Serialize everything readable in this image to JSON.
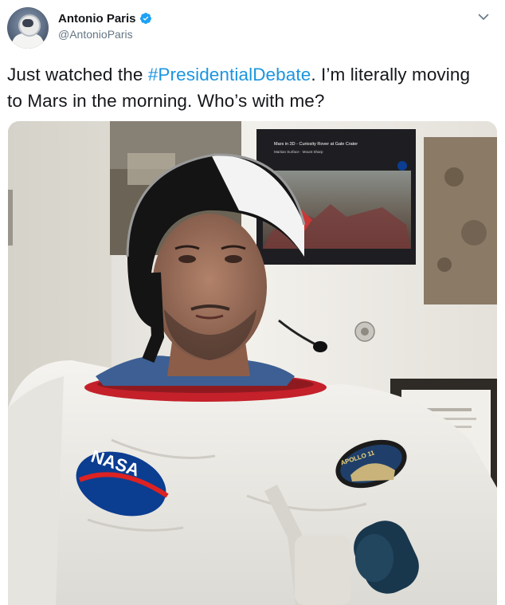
{
  "author": {
    "display_name": "Antonio Paris",
    "handle": "@AntonioParis",
    "verified": true
  },
  "tweet": {
    "text_before": "Just watched the ",
    "hashtag": "#PresidentialDebate",
    "text_after": ". I’m literally moving to Mars in the morning. Who’s with me?"
  },
  "photo": {
    "poster_caption": "Mars in 3D - Curiosity Rover at Gale Crater",
    "poster_subcaption": "Martian Surface · Mount Sharp",
    "patch_left": "NASA",
    "patch_right": "APOLLO 11"
  },
  "icons": {
    "verified": "verified-badge-icon",
    "menu": "chevron-down-icon"
  },
  "colors": {
    "hashtag": "#1b95e0",
    "verified": "#1da1f2",
    "handle": "#657786",
    "text": "#14171a"
  }
}
